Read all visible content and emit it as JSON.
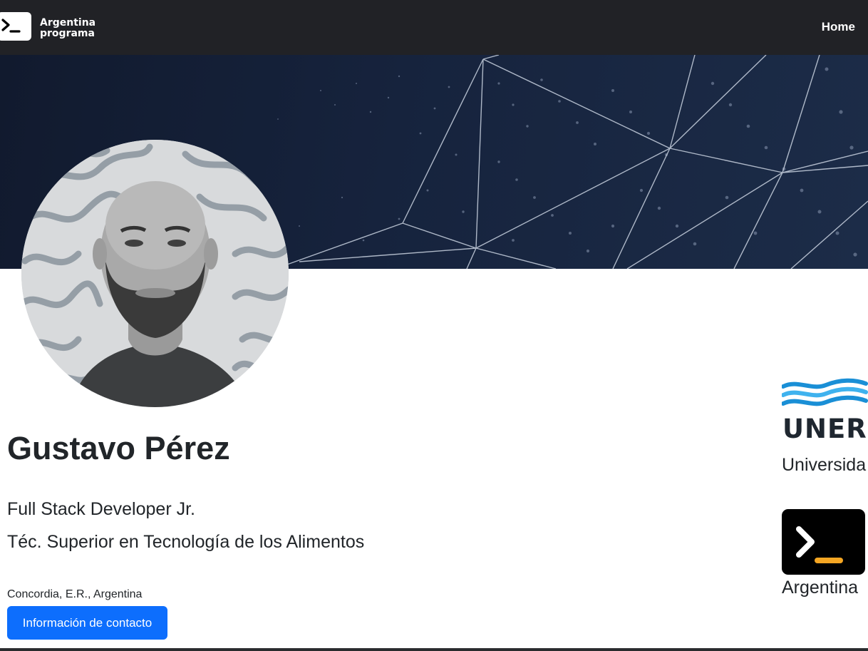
{
  "navbar": {
    "brand_line1": "Argentina",
    "brand_line2": "programa",
    "home_label": "Home"
  },
  "profile": {
    "name": "Gustavo Pérez",
    "roles": [
      "Full Stack Developer Jr.",
      "Téc. Superior en Tecnología de los Alimentos"
    ],
    "location": "Concordia, E.R., Argentina",
    "contact_button": "Información de contacto"
  },
  "education": [
    {
      "logo": "UNER",
      "label": "Universida"
    },
    {
      "logo": "argentina-programa-icon",
      "label": "Argentina"
    }
  ],
  "colors": {
    "navbar_bg": "#212226",
    "banner_bg": "#16233d",
    "primary_button": "#0d6efd",
    "uner_wave": "#1a8fd6",
    "ap_accent": "#f5a623"
  }
}
